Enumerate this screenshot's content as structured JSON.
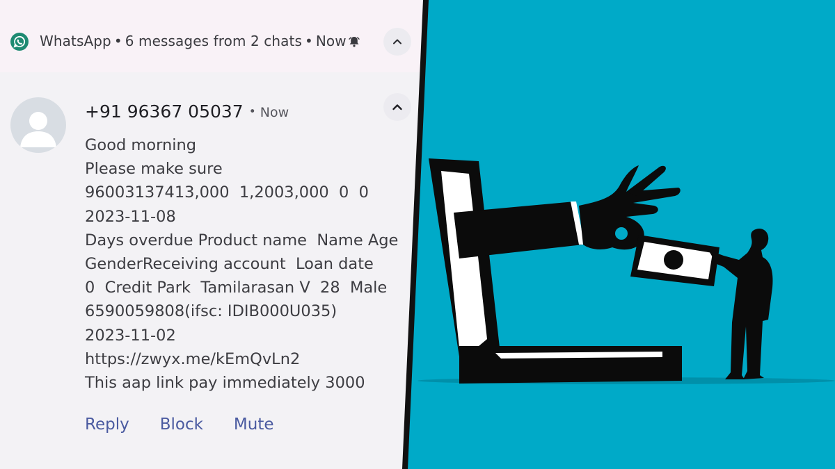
{
  "notification": {
    "app_name": "WhatsApp",
    "summary": "6 messages from 2 chats",
    "time": "Now",
    "icons": {
      "app": "whatsapp-icon",
      "bell": "bell-icon",
      "collapse": "chevron-up-icon"
    }
  },
  "message": {
    "sender": "+91 96367 05037",
    "separator": "•",
    "time": "Now",
    "lines": [
      "Good morning",
      "Please make sure",
      "96003137413,000  1,2003,000  0  0",
      "2023-11-08",
      "Days overdue Product name  Name Age",
      "GenderReceiving account  Loan date",
      "0  Credit Park  Tamilarasan V  28  Male",
      "6590059808(ifsc: IDIB000U035)",
      "2023-11-02",
      "https://zwyx.me/kEmQvLn2",
      "This aap link pay immediately 3000"
    ]
  },
  "actions": {
    "reply": "Reply",
    "block": "Block",
    "mute": "Mute"
  },
  "colors": {
    "panel_bg": "#f3f2f5",
    "header_bg": "#f9f2f7",
    "action_text": "#4a5aa0",
    "illustration_bg": "#00aac8",
    "whatsapp_green": "#1e8a72"
  }
}
